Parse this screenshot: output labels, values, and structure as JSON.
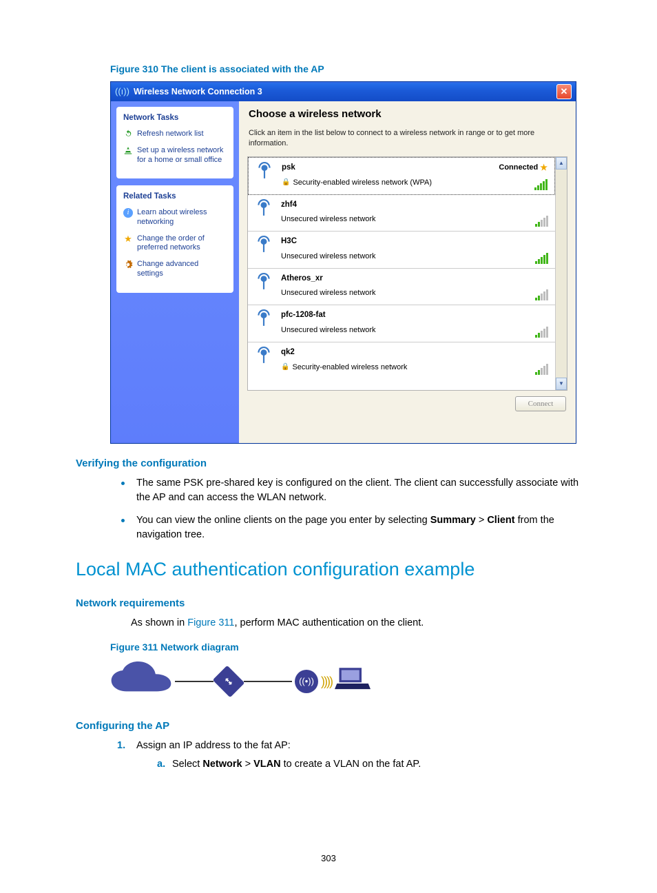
{
  "figure_caption_310": "Figure 310 The client is associated with the AP",
  "dialog": {
    "title": "Wireless Network Connection 3",
    "task_panel": {
      "network_tasks_heading": "Network Tasks",
      "refresh": "Refresh network list",
      "setup": "Set up a wireless network for a home or small office",
      "related_tasks_heading": "Related Tasks",
      "learn": "Learn about wireless networking",
      "change_order": "Change the order of preferred networks",
      "change_advanced": "Change advanced settings"
    },
    "main": {
      "heading": "Choose a wireless network",
      "instructions": "Click an item in the list below to connect to a wireless network in range or to get more information.",
      "connected_label": "Connected",
      "connect_button": "Connect"
    },
    "networks": {
      "n0": {
        "name": "psk",
        "security": "Security-enabled wireless network (WPA)"
      },
      "n1": {
        "name": "zhf4",
        "security": "Unsecured wireless network"
      },
      "n2": {
        "name": "H3C",
        "security": "Unsecured wireless network"
      },
      "n3": {
        "name": "Atheros_xr",
        "security": "Unsecured wireless network"
      },
      "n4": {
        "name": "pfc-1208-fat",
        "security": "Unsecured wireless network"
      },
      "n5": {
        "name": "qk2",
        "security": "Security-enabled wireless network"
      }
    }
  },
  "verify_heading": "Verifying the configuration",
  "verify_bullets": {
    "b1": "The same PSK pre-shared key is configured on the client. The client can successfully associate with the AP and can access the WLAN network.",
    "b2_pre": "You can view the online clients on the page you enter by selecting ",
    "b2_bold1": "Summary",
    "b2_gt": " > ",
    "b2_bold2": "Client",
    "b2_post": " from the navigation tree."
  },
  "h2": "Local MAC authentication configuration example",
  "netreq_heading": "Network requirements",
  "netreq_line_pre": "As shown in ",
  "netreq_link": "Figure 311",
  "netreq_line_post": ", perform MAC authentication on the client.",
  "figure_caption_311": "Figure 311 Network diagram",
  "config_ap_heading": "Configuring the AP",
  "step1": {
    "num": "1.",
    "text": "Assign an IP address to the fat AP:",
    "sub_a": "a.",
    "sub_a_pre": "Select ",
    "sub_a_b1": "Network",
    "sub_a_gt": " > ",
    "sub_a_b2": "VLAN",
    "sub_a_post": " to create a VLAN on the fat AP."
  },
  "page_number": "303"
}
